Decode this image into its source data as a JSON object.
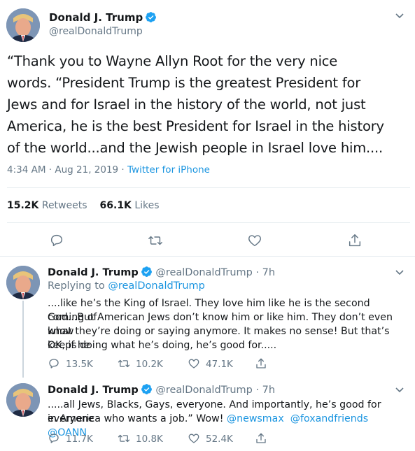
{
  "main_tweet": {
    "author_name": "Donald J. Trump",
    "author_handle": "@realDonaldTrump",
    "text_lines": [
      "“Thank you to Wayne Allyn Root for the very nice",
      "words. “President Trump is the greatest President for",
      "Jews and for Israel in the history of the world, not just",
      "America, he is the best President for Israel in the history",
      "of the world...and the Jewish people in Israel love him...."
    ],
    "timestamp": "4:34 AM · Aug 21, 2019 · ",
    "source": "Twitter for iPhone",
    "retweets_count": "15.2K",
    "retweets_label": "Retweets",
    "likes_count": "66.1K",
    "likes_label": "Likes",
    "icons": [
      "reply-icon",
      "retweet-icon",
      "like-icon",
      "share-icon",
      "verified-badge-icon",
      "chevron-down-icon"
    ]
  },
  "replies": [
    {
      "author_name": "Donald J. Trump",
      "author_handle": "@realDonaldTrump",
      "time": " · 7h",
      "replying_to_label": "Replying to ",
      "replying_to_handle": "@realDonaldTrump",
      "text_lines": [
        "....like he’s the King of Israel. They love him like he is the second coming of",
        "God...But American Jews don’t know him or like him. They don’t even know",
        "what they’re doing or saying anymore. It makes no sense! But that’s OK, if he",
        "keeps doing what he’s doing, he’s good for....."
      ],
      "reply_count": "13.5K",
      "retweet_count": "10.2K",
      "like_count": "47.1K"
    },
    {
      "author_name": "Donald J. Trump",
      "author_handle": "@realDonaldTrump",
      "time": " · 7h",
      "text_line_1": ".....all Jews, Blacks, Gays, everyone. And importantly, he’s good for everyone",
      "text_line_2_plain": "in America who wants a job.” Wow! ",
      "mentions": [
        "@newsmax",
        "@foxandfriends",
        "@OANN"
      ],
      "reply_count": "11.7K",
      "retweet_count": "10.8K",
      "like_count": "52.4K"
    }
  ],
  "colors": {
    "link_blue": "#1b95e0",
    "secondary_grey": "#657786",
    "border": "#e6ecf0",
    "thread_line": "#ccd6dd"
  }
}
